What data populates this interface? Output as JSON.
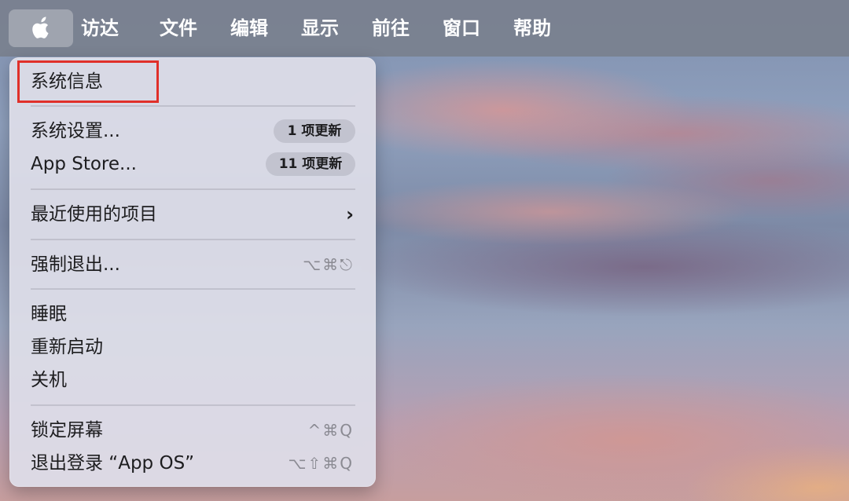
{
  "menubar": {
    "apple_icon": "apple-logo-icon",
    "items": [
      "访达",
      "文件",
      "编辑",
      "显示",
      "前往",
      "窗口",
      "帮助"
    ]
  },
  "apple_menu": {
    "system_info": "系统信息",
    "system_settings": "系统设置...",
    "system_settings_badge": "1 项更新",
    "app_store": "App Store...",
    "app_store_badge": "11 项更新",
    "recent_items": "最近使用的项目",
    "force_quit": "强制退出...",
    "force_quit_shortcut": "⌥⌘⎋",
    "sleep": "睡眠",
    "restart": "重新启动",
    "shutdown": "关机",
    "lock_screen": "锁定屏幕",
    "lock_screen_shortcut": "^⌘Q",
    "logout": "退出登录 “App OS”",
    "logout_shortcut": "⌥⇧⌘Q"
  },
  "colors": {
    "highlight": "#e0302a",
    "menubar_bg": "#7a808e"
  }
}
